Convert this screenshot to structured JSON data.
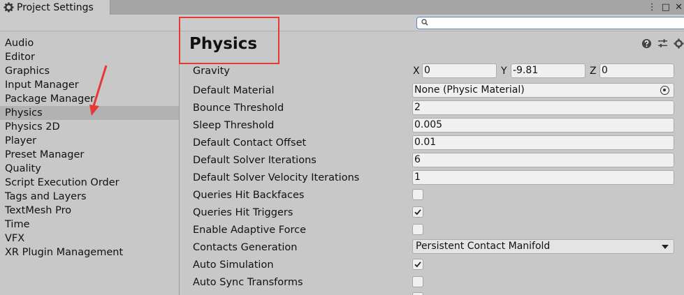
{
  "window": {
    "tab_title": "Project Settings",
    "menu_glyph": "⋮",
    "maximize_glyph": "□",
    "close_glyph": "✕"
  },
  "search": {
    "placeholder": "",
    "value": ""
  },
  "sidebar": {
    "items": [
      {
        "label": "Audio"
      },
      {
        "label": "Editor"
      },
      {
        "label": "Graphics"
      },
      {
        "label": "Input Manager"
      },
      {
        "label": "Package Manager"
      },
      {
        "label": "Physics",
        "selected": true
      },
      {
        "label": "Physics 2D"
      },
      {
        "label": "Player"
      },
      {
        "label": "Preset Manager"
      },
      {
        "label": "Quality"
      },
      {
        "label": "Script Execution Order"
      },
      {
        "label": "Tags and Layers"
      },
      {
        "label": "TextMesh Pro"
      },
      {
        "label": "Time"
      },
      {
        "label": "VFX"
      },
      {
        "label": "XR Plugin Management"
      }
    ]
  },
  "main": {
    "title": "Physics",
    "gravity": {
      "label": "Gravity",
      "x_label": "X",
      "x": "0",
      "y_label": "Y",
      "y": "-9.81",
      "z_label": "Z",
      "z": "0"
    },
    "default_material": {
      "label": "Default Material",
      "value": "None (Physic Material)"
    },
    "bounce_threshold": {
      "label": "Bounce Threshold",
      "value": "2"
    },
    "sleep_threshold": {
      "label": "Sleep Threshold",
      "value": "0.005"
    },
    "default_contact_offset": {
      "label": "Default Contact Offset",
      "value": "0.01"
    },
    "default_solver_iterations": {
      "label": "Default Solver Iterations",
      "value": "6"
    },
    "default_solver_velocity_iterations": {
      "label": "Default Solver Velocity Iterations",
      "value": "1"
    },
    "queries_hit_backfaces": {
      "label": "Queries Hit Backfaces",
      "checked": false
    },
    "queries_hit_triggers": {
      "label": "Queries Hit Triggers",
      "checked": true
    },
    "enable_adaptive_force": {
      "label": "Enable Adaptive Force",
      "checked": false
    },
    "contacts_generation": {
      "label": "Contacts Generation",
      "value": "Persistent Contact Manifold"
    },
    "auto_simulation": {
      "label": "Auto Simulation",
      "checked": true
    },
    "auto_sync_transforms": {
      "label": "Auto Sync Transforms",
      "checked": false
    }
  },
  "colors": {
    "annotation_red": "#e53935",
    "selection": "#b2b2b2",
    "panel": "#c8c8c8"
  }
}
